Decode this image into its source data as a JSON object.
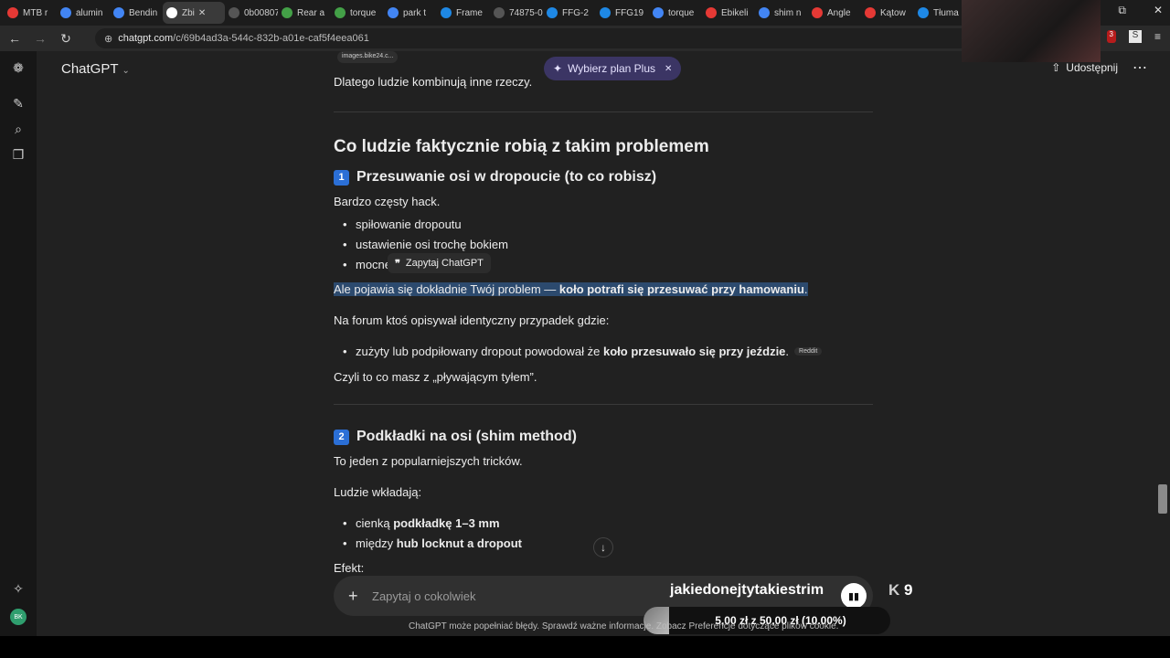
{
  "browser": {
    "tabs": [
      {
        "label": "MTB r",
        "color": "#e53935"
      },
      {
        "label": "alumin",
        "color": "#4285f4"
      },
      {
        "label": "Bendin",
        "color": "#4285f4"
      },
      {
        "label": "Zbi",
        "color": "#ffffff",
        "active": true
      },
      {
        "label": "0b00807f",
        "color": "#555555"
      },
      {
        "label": "Rear a",
        "color": "#43a047"
      },
      {
        "label": "torque",
        "color": "#43a047"
      },
      {
        "label": "park t",
        "color": "#4285f4"
      },
      {
        "label": "Frame",
        "color": "#1e88e5"
      },
      {
        "label": "74875-02",
        "color": "#555555"
      },
      {
        "label": "FFG-2",
        "color": "#1e88e5"
      },
      {
        "label": "FFG19",
        "color": "#1e88e5"
      },
      {
        "label": "torque",
        "color": "#4285f4"
      },
      {
        "label": "Ebikeli",
        "color": "#e53935"
      },
      {
        "label": "shim n",
        "color": "#4285f4"
      },
      {
        "label": "Angle",
        "color": "#e53935"
      },
      {
        "label": "Kątow",
        "color": "#e53935"
      },
      {
        "label": "Tłuma",
        "color": "#1e88e5"
      }
    ],
    "url_domain": "chatgpt.com",
    "url_path": "/c/69b4ad3a-544c-832b-a01e-caf5f4eea061",
    "ext_badge": "3"
  },
  "header": {
    "brand": "ChatGPT",
    "plus_button": "Wybierz plan Plus",
    "share": "Udostępnij"
  },
  "chat": {
    "source_chip": "images.bike24.c...",
    "intro": "Dlatego ludzie kombinują inne rzeczy.",
    "heading": "Co ludzie faktycznie robią z takim problemem",
    "s1_num": "1",
    "s1_title": "Przesuwanie osi w dropoucie (to co robisz)",
    "s1_lead": "Bardzo częsty hack.",
    "s1_items": [
      "spiłowanie dropoutu",
      "ustawienie osi trochę bokiem",
      "mocne"
    ],
    "s1_warn_a": "Ale pojawia się dokładnie Twój problem — ",
    "s1_warn_b": "koło potrafi się przesuwać przy hamowaniu",
    "s1_warn_c": ".",
    "s1_forum": "Na forum ktoś opisywał identyczny przypadek gdzie:",
    "s1_forum_item_a": "zużyty lub podpiłowany dropout powodował że ",
    "s1_forum_item_b": "koło przesuwało się przy jeździe",
    "s1_forum_item_c": ".",
    "s1_reddit": "Reddit",
    "s1_summary": "Czyli to co masz z „pływającym tyłem”.",
    "s2_num": "2",
    "s2_title": "Podkładki na osi (shim method)",
    "s2_lead": "To jeden z popularniejszych tricków.",
    "s2_people": "Ludzie wkładają:",
    "s2_item1_a": "cienką ",
    "s2_item1_b": "podkładkę 1–3 mm",
    "s2_item2_a": "między ",
    "s2_item2_b": "hub locknut a dropout",
    "s2_effect": "Efekt:"
  },
  "tooltip": "Zapytaj ChatGPT",
  "composer": {
    "placeholder": "Zapytaj o cokolwiek"
  },
  "overlay": {
    "stream_text": "jakiedonejtytakiestrim",
    "k_value": "9",
    "donation": "5,00 zł z 50,00 zł (10.00%)",
    "donation_progress": 0.1
  },
  "disclaimer": "ChatGPT może popełniać błędy. Sprawdź ważne informacje. Zobacz Preferencje dotyczące plików cookie."
}
